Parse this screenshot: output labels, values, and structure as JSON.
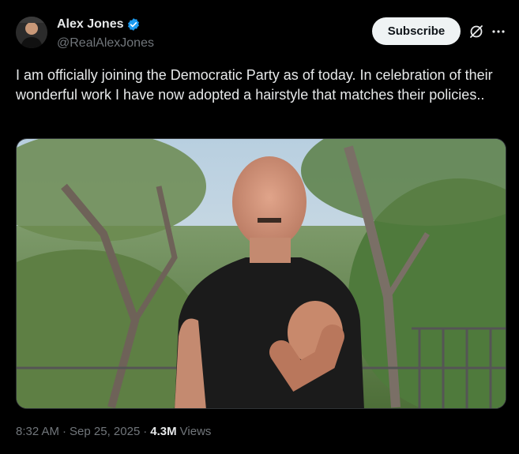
{
  "author": {
    "display_name": "Alex Jones",
    "handle": "@RealAlexJones",
    "verified_color": "#1d9bf0"
  },
  "actions": {
    "subscribe_label": "Subscribe",
    "grok_icon": "grok-icon",
    "more_icon": "more-dots-icon"
  },
  "post": {
    "text": "I am officially joining the Democratic Party as of today.  In celebration of their wonderful work I have now adopted a hairstyle that matches their policies..",
    "time": "8:32 AM",
    "separator": "·",
    "date": "Sep 25, 2025",
    "views_count": "4.3M",
    "views_label": "Views"
  },
  "colors": {
    "background": "#000000",
    "text_primary": "#e7e9ea",
    "text_secondary": "#71767b",
    "button_bg": "#eff3f4"
  }
}
